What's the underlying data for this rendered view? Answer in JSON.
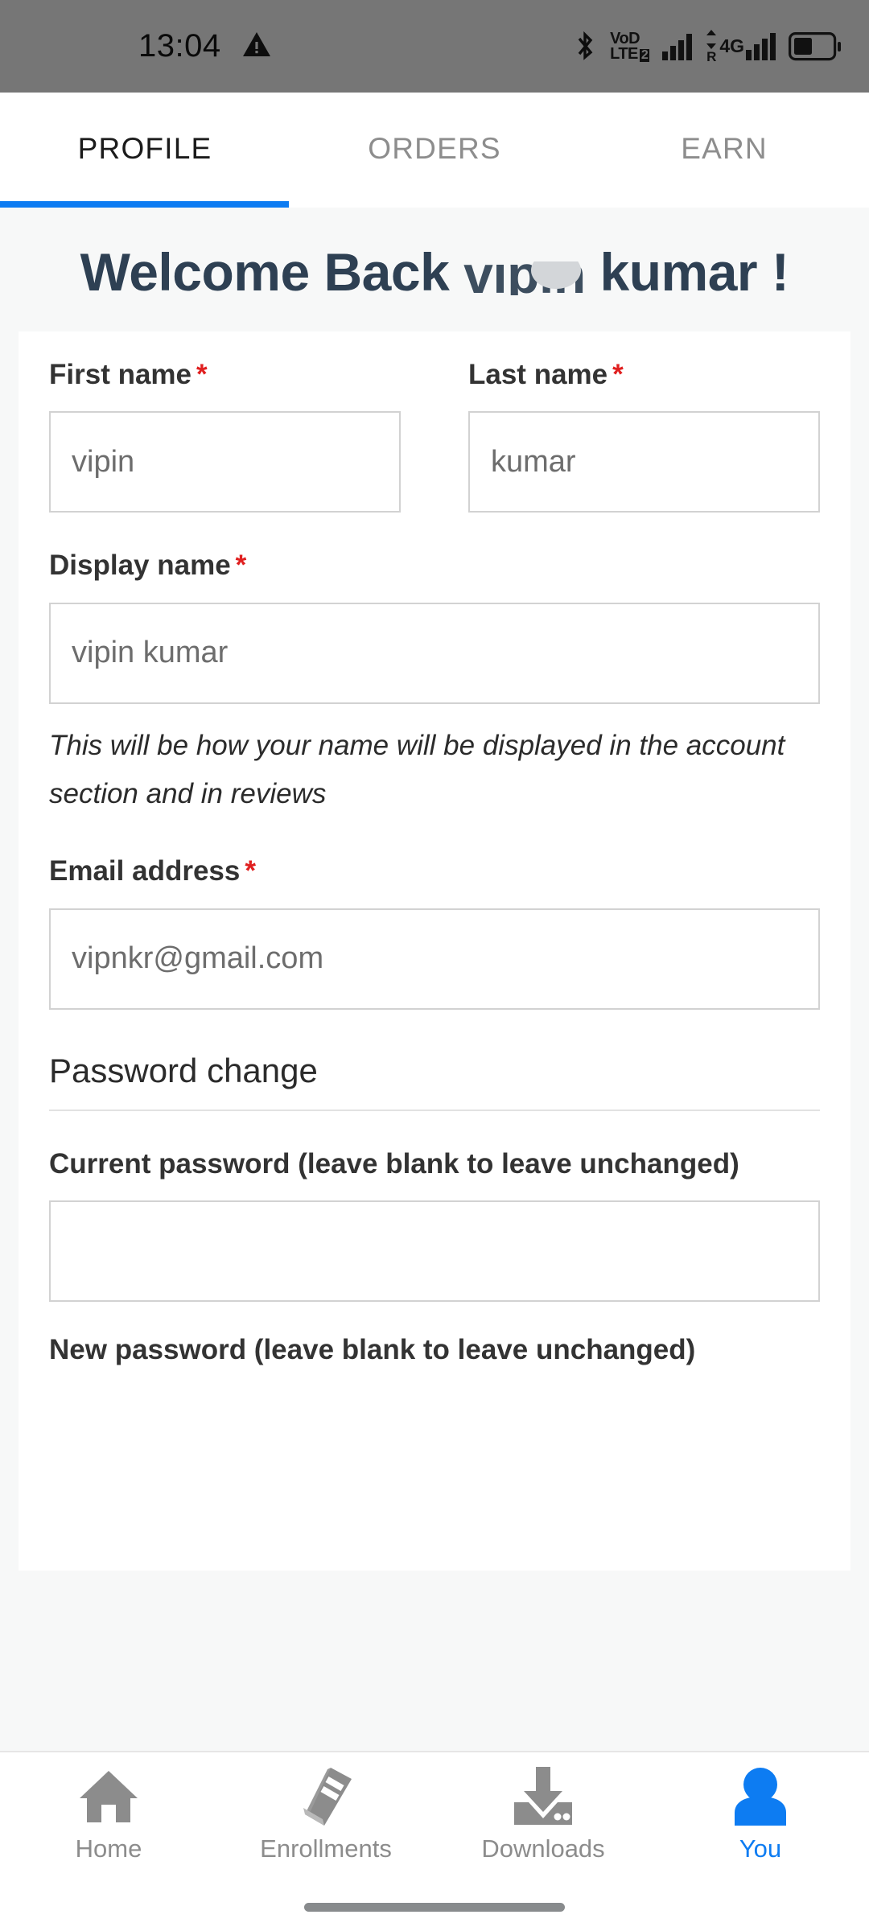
{
  "statusbar": {
    "time": "13:04",
    "warning_icon": "warning-triangle-icon",
    "bluetooth_icon": "bluetooth-icon",
    "volte_label_top": "VoD",
    "volte_label_bottom": "LTE",
    "volte_sim_badge": "2",
    "network_type": "4G",
    "roaming_label": "R",
    "battery_icon": "battery-icon"
  },
  "tabs": [
    {
      "label": "PROFILE",
      "active": true
    },
    {
      "label": "ORDERS",
      "active": false
    },
    {
      "label": "EARN",
      "active": false
    }
  ],
  "hero": {
    "greeting_prefix": "Welcome Back",
    "user_first_name": "vipin",
    "user_last_name": "kumar !"
  },
  "form": {
    "first_name": {
      "label": "First name",
      "required_mark": "*",
      "value": "vipin"
    },
    "last_name": {
      "label": "Last name",
      "required_mark": "*",
      "value": "kumar"
    },
    "display_name": {
      "label": "Display name",
      "required_mark": "*",
      "value": "vipin kumar",
      "help": "This will be how your name will be displayed in the account section and in reviews"
    },
    "email": {
      "label": "Email address",
      "required_mark": "*",
      "value": "vipnkr@gmail.com"
    },
    "password_section_title": "Password change",
    "current_password": {
      "label": "Current password (leave blank to leave unchanged)",
      "value": ""
    },
    "new_password": {
      "label": "New password (leave blank to leave unchanged)",
      "value": ""
    }
  },
  "bottom_nav": [
    {
      "label": "Home",
      "icon": "home-icon",
      "active": false
    },
    {
      "label": "Enrollments",
      "icon": "book-icon",
      "active": false
    },
    {
      "label": "Downloads",
      "icon": "download-tray-icon",
      "active": false
    },
    {
      "label": "You",
      "icon": "person-icon",
      "active": true
    }
  ],
  "colors": {
    "accent": "#0d7cf2",
    "statusbar_bg": "#767676",
    "heading": "#2e4053",
    "required": "#e02020",
    "page_bg": "#f7f8f8",
    "nav_inactive": "#8c8c8c"
  }
}
